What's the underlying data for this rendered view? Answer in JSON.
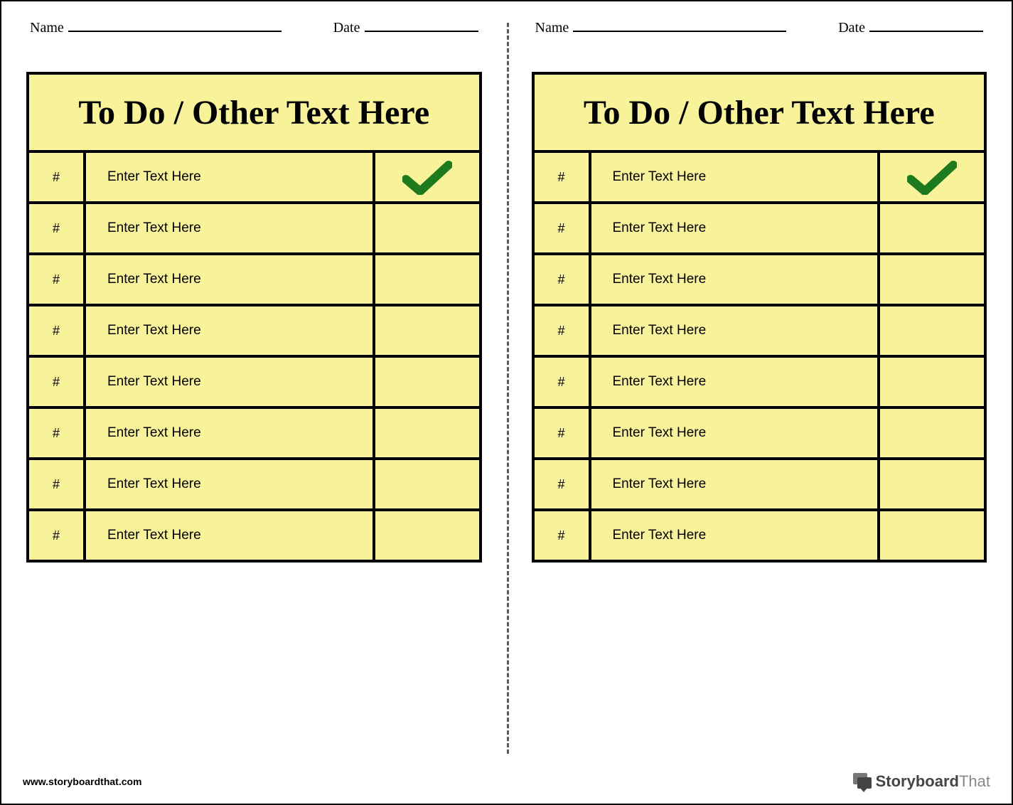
{
  "labels": {
    "name": "Name",
    "date": "Date"
  },
  "panels": [
    {
      "header": "To Do / Other Text Here",
      "rows": [
        {
          "num": "#",
          "text": "Enter Text Here",
          "checked": true
        },
        {
          "num": "#",
          "text": "Enter Text Here",
          "checked": false
        },
        {
          "num": "#",
          "text": "Enter Text Here",
          "checked": false
        },
        {
          "num": "#",
          "text": "Enter Text Here",
          "checked": false
        },
        {
          "num": "#",
          "text": "Enter Text Here",
          "checked": false
        },
        {
          "num": "#",
          "text": "Enter Text Here",
          "checked": false
        },
        {
          "num": "#",
          "text": "Enter Text Here",
          "checked": false
        },
        {
          "num": "#",
          "text": "Enter Text Here",
          "checked": false
        }
      ]
    },
    {
      "header": "To Do / Other Text Here",
      "rows": [
        {
          "num": "#",
          "text": "Enter Text Here",
          "checked": true
        },
        {
          "num": "#",
          "text": "Enter Text Here",
          "checked": false
        },
        {
          "num": "#",
          "text": "Enter Text Here",
          "checked": false
        },
        {
          "num": "#",
          "text": "Enter Text Here",
          "checked": false
        },
        {
          "num": "#",
          "text": "Enter Text Here",
          "checked": false
        },
        {
          "num": "#",
          "text": "Enter Text Here",
          "checked": false
        },
        {
          "num": "#",
          "text": "Enter Text Here",
          "checked": false
        },
        {
          "num": "#",
          "text": "Enter Text Here",
          "checked": false
        }
      ]
    }
  ],
  "footer": {
    "url": "www.storyboardthat.com",
    "brand1": "Storyboard",
    "brand2": "That"
  }
}
